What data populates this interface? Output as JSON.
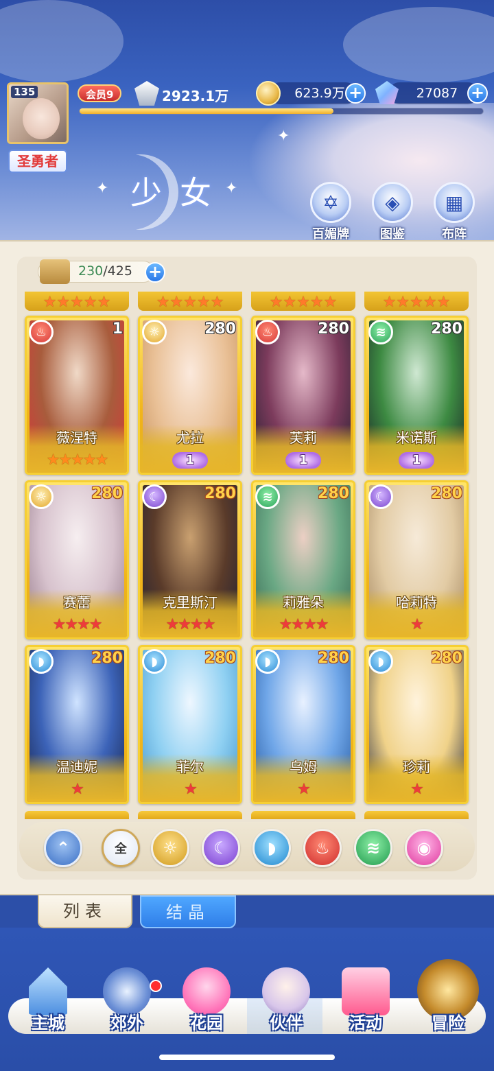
{
  "header": {
    "avatar_level": "135",
    "player_title": "圣勇者",
    "vip": "会员9",
    "power": "2923.1万",
    "exp_fraction": 0.63,
    "gold": "623.9万",
    "gems": "27087",
    "page_title": "少女"
  },
  "shortcuts": [
    {
      "label": "百媚牌",
      "icon": "card-deck-icon"
    },
    {
      "label": "图鉴",
      "icon": "book-icon"
    },
    {
      "label": "布阵",
      "icon": "grid-formation-icon"
    }
  ],
  "inventory": {
    "current": "230",
    "sep": "/",
    "max": "425"
  },
  "cards": [
    {
      "name": "薇涅特",
      "level": "1",
      "element": "fire",
      "stars": 5,
      "star_color": "orange",
      "rank": null,
      "art": [
        "#f0d9c7",
        "#a85c3c",
        "#d33a3a"
      ]
    },
    {
      "name": "尤拉",
      "level": "280",
      "element": "light",
      "stars": 0,
      "star_color": "orange",
      "rank": "1",
      "art": [
        "#fbe9dc",
        "#e9c096",
        "#c9945f"
      ]
    },
    {
      "name": "芙莉",
      "level": "280",
      "element": "fire",
      "stars": 0,
      "star_color": "orange",
      "rank": "1",
      "art": [
        "#e5b9c9",
        "#7c3b5c",
        "#2b2234"
      ]
    },
    {
      "name": "米诺斯",
      "level": "280",
      "element": "wind",
      "stars": 0,
      "star_color": "orange",
      "rank": "1",
      "art": [
        "#cfe8d2",
        "#3d8a42",
        "#1d2b2a"
      ]
    },
    {
      "name": "赛蕾",
      "level": "280",
      "element": "light",
      "stars": 4,
      "star_color": "red",
      "rank": null,
      "art": [
        "#f6eef0",
        "#d7c2cd",
        "#9a7f8f"
      ]
    },
    {
      "name": "克里斯汀",
      "level": "280",
      "element": "dark",
      "stars": 4,
      "star_color": "red",
      "rank": null,
      "art": [
        "#c9a070",
        "#5a3b2a",
        "#242233"
      ]
    },
    {
      "name": "莉雅朵",
      "level": "280",
      "element": "wind",
      "stars": 4,
      "star_color": "red",
      "rank": null,
      "art": [
        "#eccfc4",
        "#6aa884",
        "#3a6c56"
      ]
    },
    {
      "name": "哈莉特",
      "level": "280",
      "element": "dark",
      "stars": 1,
      "star_color": "red",
      "rank": null,
      "art": [
        "#f6ead8",
        "#e2cba4",
        "#a88b64"
      ]
    },
    {
      "name": "温迪妮",
      "level": "280",
      "element": "water",
      "stars": 1,
      "star_color": "red",
      "rank": null,
      "art": [
        "#cfe3ff",
        "#3c63b8",
        "#1b2a55"
      ]
    },
    {
      "name": "菲尔",
      "level": "280",
      "element": "water",
      "stars": 1,
      "star_color": "red",
      "rank": null,
      "art": [
        "#eef7ff",
        "#8fd0f2",
        "#4a9ad0"
      ]
    },
    {
      "name": "乌姆",
      "level": "280",
      "element": "water",
      "stars": 1,
      "star_color": "red",
      "rank": null,
      "art": [
        "#e8f1ff",
        "#6fa6e8",
        "#2b5fa6"
      ]
    },
    {
      "name": "珍莉",
      "level": "280",
      "element": "water",
      "stars": 1,
      "star_color": "red",
      "rank": null,
      "art": [
        "#fff3dc",
        "#f0d289",
        "#3b3c48"
      ]
    }
  ],
  "filters": [
    {
      "icon": "all-elements-icon",
      "label": ""
    },
    {
      "icon": "all-icon",
      "label": "全"
    },
    {
      "icon": "light-element-icon",
      "label": ""
    },
    {
      "icon": "dark-element-icon",
      "label": ""
    },
    {
      "icon": "water-element-icon",
      "label": ""
    },
    {
      "icon": "fire-element-icon",
      "label": ""
    },
    {
      "icon": "wind-element-icon",
      "label": ""
    },
    {
      "icon": "special-element-icon",
      "label": ""
    }
  ],
  "tabs": {
    "list": "列表",
    "crystal": "结晶"
  },
  "nav": [
    {
      "label": "主城",
      "icon": "castle-icon"
    },
    {
      "label": "郊外",
      "icon": "portal-icon"
    },
    {
      "label": "花园",
      "icon": "heart-garden-icon"
    },
    {
      "label": "伙伴",
      "icon": "partner-portrait-icon"
    },
    {
      "label": "活动",
      "icon": "gift-box-icon"
    },
    {
      "label": "冒险",
      "icon": "compass-sword-icon"
    }
  ],
  "colors": {
    "accent_gold": "#f1b51b",
    "accent_blue": "#2f7ee8",
    "counter_green": "#3c8a54"
  }
}
